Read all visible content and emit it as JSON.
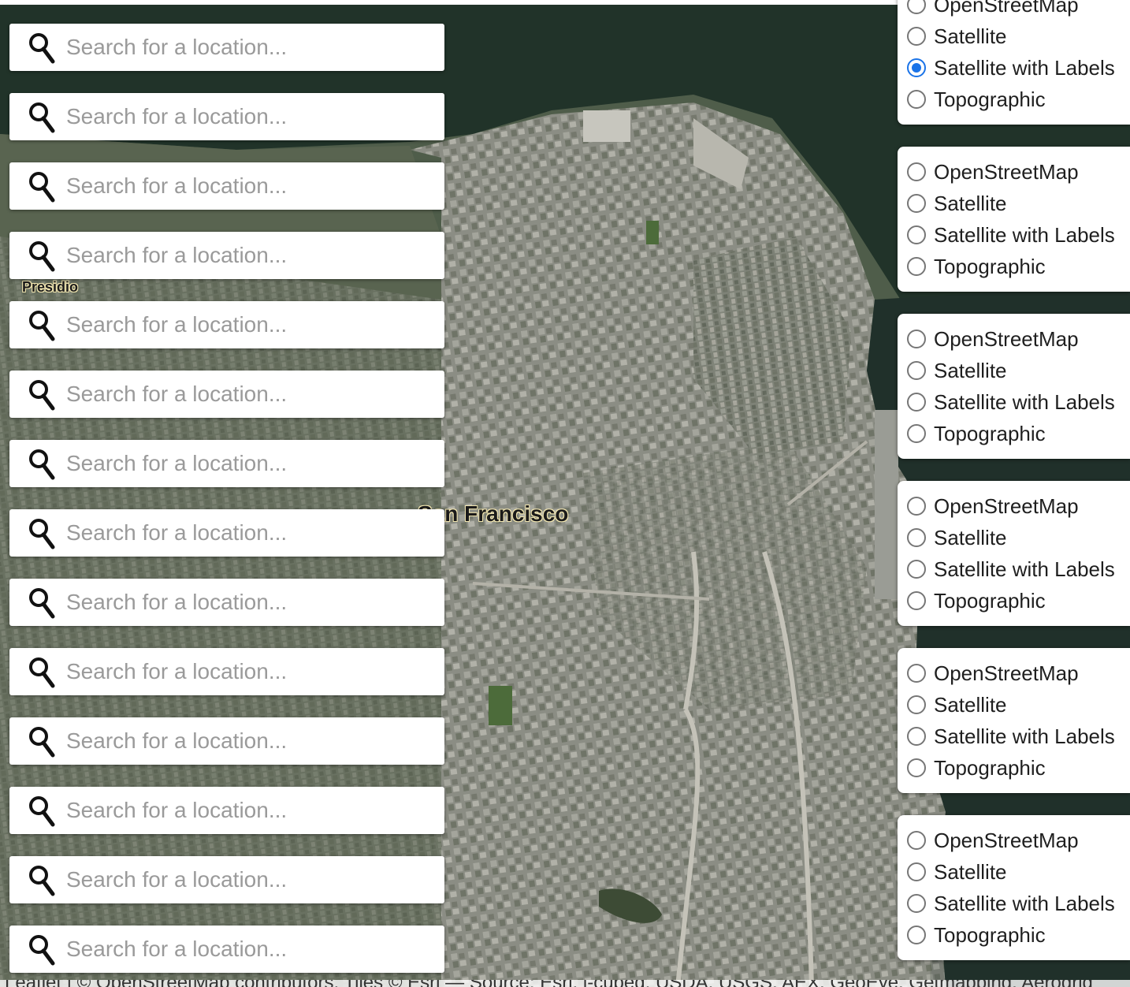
{
  "search": {
    "placeholder": "Search for a location...",
    "boxes": [
      1,
      2,
      3,
      4,
      5,
      6,
      7,
      8,
      9,
      10,
      11,
      12,
      13,
      14
    ]
  },
  "layers": {
    "options": [
      "OpenStreetMap",
      "Satellite",
      "Satellite with Labels",
      "Topographic"
    ],
    "selected": "Satellite with Labels"
  },
  "map": {
    "labels": {
      "presidio": "Presidio",
      "san_francisco": "San Francisco"
    }
  },
  "attribution": "Leaflet | © OpenStreetMap contributors, Tiles © Esri — Source: Esri, i-cubed, USDA, USGS, AEX, GeoEye, Getmapping, Aerogrid"
}
